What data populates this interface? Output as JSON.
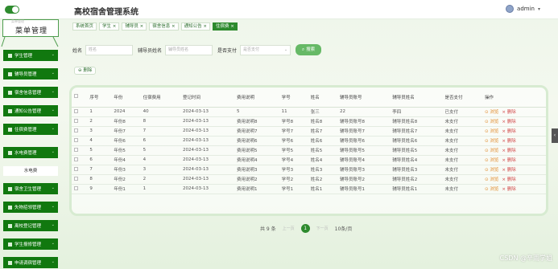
{
  "header": {
    "title": "高校宿舍管理系统",
    "user": "admin"
  },
  "sidebar": {
    "menu_title": "菜单管理",
    "ghost_text": "菜单管理",
    "items": [
      {
        "label": "学生管理"
      },
      {
        "label": "辅导员管理"
      },
      {
        "label": "宿舍信息管理"
      },
      {
        "label": "通知公告管理"
      },
      {
        "label": "住宿费管理"
      },
      {
        "label": "水电费管理"
      },
      {
        "label": "宿舍卫生管理"
      },
      {
        "label": "失物招领管理"
      },
      {
        "label": "离校登记管理"
      },
      {
        "label": "学生报修管理"
      },
      {
        "label": "申请调宿管理"
      }
    ],
    "submenu": "水电费"
  },
  "tags": [
    {
      "label": "系统首页",
      "closable": false,
      "active": false
    },
    {
      "label": "学生",
      "closable": true,
      "active": false
    },
    {
      "label": "辅导员",
      "closable": true,
      "active": false
    },
    {
      "label": "宿舍信息",
      "closable": true,
      "active": false
    },
    {
      "label": "通知公告",
      "closable": true,
      "active": false
    },
    {
      "label": "住宿费",
      "closable": true,
      "active": true
    }
  ],
  "search": {
    "name_label": "姓名",
    "name_placeholder": "姓名",
    "counselor_label": "辅导员姓名",
    "counselor_placeholder": "辅导员姓名",
    "paid_label": "是否支付",
    "paid_placeholder": "是否支付",
    "search_button": "搜索",
    "delete_button": "删除"
  },
  "table": {
    "columns": [
      "序号",
      "年份",
      "住宿费用",
      "登记时间",
      "费用说明",
      "学号",
      "姓名",
      "辅导员账号",
      "辅导员姓名",
      "是否支付",
      "操作"
    ],
    "rows": [
      [
        "1",
        "2024",
        "40",
        "2024-03-13",
        "5",
        "11",
        "张三",
        "22",
        "李四",
        "已支付"
      ],
      [
        "2",
        "年份8",
        "8",
        "2024-03-13",
        "费用说明8",
        "学号8",
        "姓名8",
        "辅导员账号8",
        "辅导员姓名8",
        "未支付"
      ],
      [
        "3",
        "年份7",
        "7",
        "2024-03-13",
        "费用说明7",
        "学号7",
        "姓名7",
        "辅导员账号7",
        "辅导员姓名7",
        "未支付"
      ],
      [
        "4",
        "年份6",
        "6",
        "2024-03-13",
        "费用说明6",
        "学号6",
        "姓名6",
        "辅导员账号6",
        "辅导员姓名6",
        "未支付"
      ],
      [
        "5",
        "年份5",
        "5",
        "2024-03-13",
        "费用说明5",
        "学号5",
        "姓名5",
        "辅导员账号5",
        "辅导员姓名5",
        "未支付"
      ],
      [
        "6",
        "年份4",
        "4",
        "2024-03-13",
        "费用说明4",
        "学号4",
        "姓名4",
        "辅导员账号4",
        "辅导员姓名4",
        "未支付"
      ],
      [
        "7",
        "年份3",
        "3",
        "2024-03-13",
        "费用说明3",
        "学号3",
        "姓名3",
        "辅导员账号3",
        "辅导员姓名3",
        "未支付"
      ],
      [
        "8",
        "年份2",
        "2",
        "2024-03-13",
        "费用说明2",
        "学号2",
        "姓名2",
        "辅导员账号2",
        "辅导员姓名2",
        "未支付"
      ],
      [
        "9",
        "年份1",
        "1",
        "2024-03-13",
        "费用说明1",
        "学号1",
        "姓名1",
        "辅导员账号1",
        "辅导员姓名1",
        "未支付"
      ]
    ],
    "action_view": "浏览",
    "action_delete": "删除"
  },
  "pager": {
    "total": "共 9 条",
    "prev": "上一页",
    "current": "1",
    "next": "下一页",
    "page_size": "10条/页"
  },
  "watermark": "CSDN @辛雨学姐",
  "colors": {
    "primary": "#11780f",
    "active_tag": "#2d8a2d",
    "search_button": "#66b966",
    "view_action": "#e08a2a",
    "delete_action": "#d24a4a"
  }
}
